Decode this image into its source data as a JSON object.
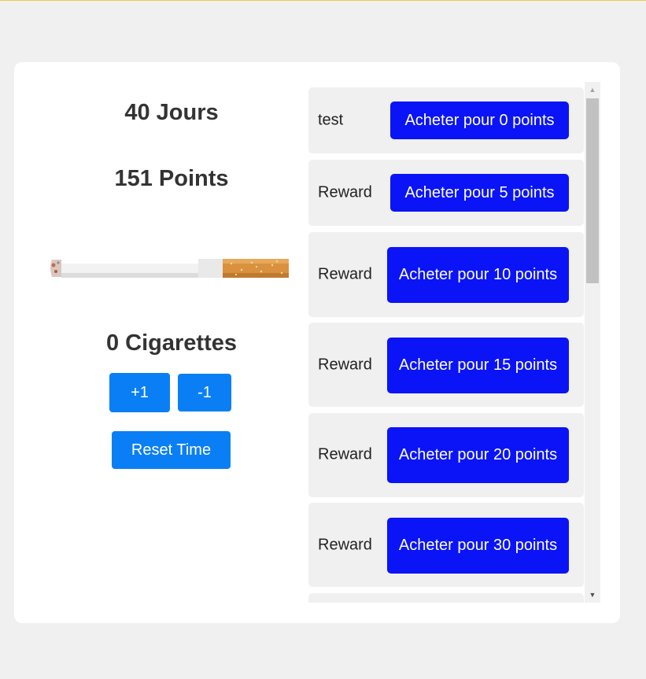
{
  "stats": {
    "days": "40 Jours",
    "points": "151 Points",
    "cigarettes": "0 Cigarettes"
  },
  "controls": {
    "plus_label": "+1",
    "minus_label": "-1",
    "reset_label": "Reset Time"
  },
  "rewards": [
    {
      "name": "test",
      "button": "Acheter pour 0 points"
    },
    {
      "name": "Reward",
      "button": "Acheter pour 5 points"
    },
    {
      "name": "Reward",
      "button": "Acheter pour 10 points"
    },
    {
      "name": "Reward",
      "button": "Acheter pour 15 points"
    },
    {
      "name": "Reward",
      "button": "Acheter pour 20 points"
    },
    {
      "name": "Reward",
      "button": "Acheter pour 30 points"
    }
  ],
  "colors": {
    "primary_button": "#0a7ff5",
    "buy_button": "#0a14f7",
    "reward_bg": "#f0f0f0",
    "page_bg": "#f0f0f0"
  },
  "icons": {
    "image": "cigarette-image",
    "scroll_up": "scroll-up-arrow-icon",
    "scroll_down": "scroll-down-arrow-icon"
  }
}
